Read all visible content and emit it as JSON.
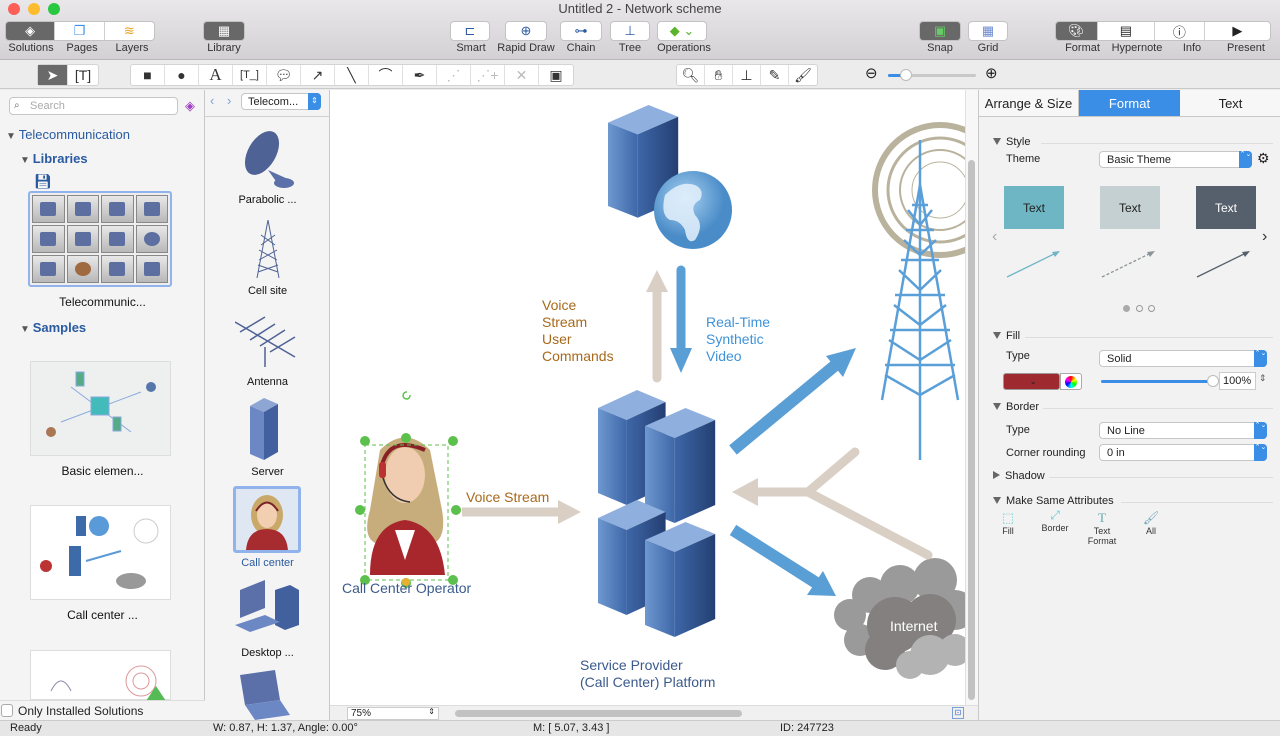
{
  "window": {
    "title": "Untitled 2 - Network scheme"
  },
  "toolbar": {
    "left_group": [
      {
        "label": "Solutions",
        "icon": "solutions-icon",
        "active": true
      },
      {
        "label": "Pages",
        "icon": "pages-icon"
      },
      {
        "label": "Layers",
        "icon": "layers-icon"
      }
    ],
    "library": {
      "label": "Library",
      "icon": "library-icon",
      "active": true
    },
    "center_group": [
      {
        "label": "Smart",
        "icon": "smart-connector-icon"
      },
      {
        "label": "Rapid Draw",
        "icon": "rapid-draw-icon"
      },
      {
        "label": "Chain",
        "icon": "chain-icon"
      },
      {
        "label": "Tree",
        "icon": "tree-icon"
      },
      {
        "label": "Operations",
        "icon": "operations-icon"
      }
    ],
    "snap": {
      "label": "Snap",
      "active": true
    },
    "grid": {
      "label": "Grid"
    },
    "right_group": [
      {
        "label": "Format",
        "icon": "format-icon",
        "active": true
      },
      {
        "label": "Hypernote",
        "icon": "hypernote-icon"
      },
      {
        "label": "Info",
        "icon": "info-icon"
      },
      {
        "label": "Present",
        "icon": "present-icon"
      }
    ]
  },
  "tools": {
    "select": [
      "pointer",
      "text-select"
    ],
    "draw": [
      "rectangle",
      "ellipse",
      "text",
      "text-box",
      "callout",
      "arrow",
      "line",
      "arc",
      "pen",
      "edit-points",
      "add-point",
      "delete-point",
      "container"
    ],
    "view": [
      "zoom",
      "pan",
      "stamp",
      "eyedropper",
      "format-painter"
    ],
    "zoom_slider_fraction": 0.2
  },
  "left": {
    "search_placeholder": "Search",
    "category": "Telecommunication",
    "libraries_label": "Libraries",
    "library_name": "Telecommunic...",
    "samples_label": "Samples",
    "samples": [
      "Basic elemen...",
      "Call center ..."
    ],
    "only_installed": "Only Installed Solutions"
  },
  "library": {
    "dropdown": "Telecom...",
    "items": [
      "Parabolic ...",
      "Cell site",
      "Antenna",
      "Server",
      "Call center",
      "Desktop  ..."
    ],
    "selected": "Call center"
  },
  "diagram": {
    "voice_cmd": [
      "Voice",
      "Stream",
      "User",
      "Commands"
    ],
    "rt_video": [
      "Real-Time",
      "Synthetic",
      "Video"
    ],
    "voice_stream": "Voice Stream",
    "operator": "Call Center Operator",
    "internet": "Internet",
    "platform": [
      "Service Provider",
      "(Call Center) Platform"
    ],
    "colors": {
      "orange": "#a8691c",
      "blue": "#3f92d8",
      "beige": "#d9cfc4",
      "server": "#3d6aa8",
      "label": "#3b5a8c"
    }
  },
  "canvas_footer": {
    "zoom": "75%"
  },
  "status": {
    "ready": "Ready",
    "dims": "W: 0.87,  H: 1.37,  Angle: 0.00°",
    "mouse": "M: [ 5.07, 3.43 ]",
    "id": "ID: 247723"
  },
  "right": {
    "tabs": [
      "Arrange & Size",
      "Format",
      "Text"
    ],
    "active_tab": "Format",
    "style": "Style",
    "theme_label": "Theme",
    "theme": "Basic Theme",
    "swatches": [
      {
        "text": "Text",
        "bg": "#6fb6c4"
      },
      {
        "text": "Text",
        "bg": "#c5d0d3"
      },
      {
        "text": "Text",
        "bg": "#56606c"
      }
    ],
    "fill": "Fill",
    "fill_type_label": "Type",
    "fill_type": "Solid",
    "fill_color": "#9e2a30",
    "opacity": "100%",
    "border": "Border",
    "border_type_label": "Type",
    "border_type": "No Line",
    "corner_label": "Corner rounding",
    "corner": "0 in",
    "shadow": "Shadow",
    "msa": "Make Same Attributes",
    "msa_items": [
      "Fill",
      "Border",
      "Text Format",
      "All"
    ]
  }
}
